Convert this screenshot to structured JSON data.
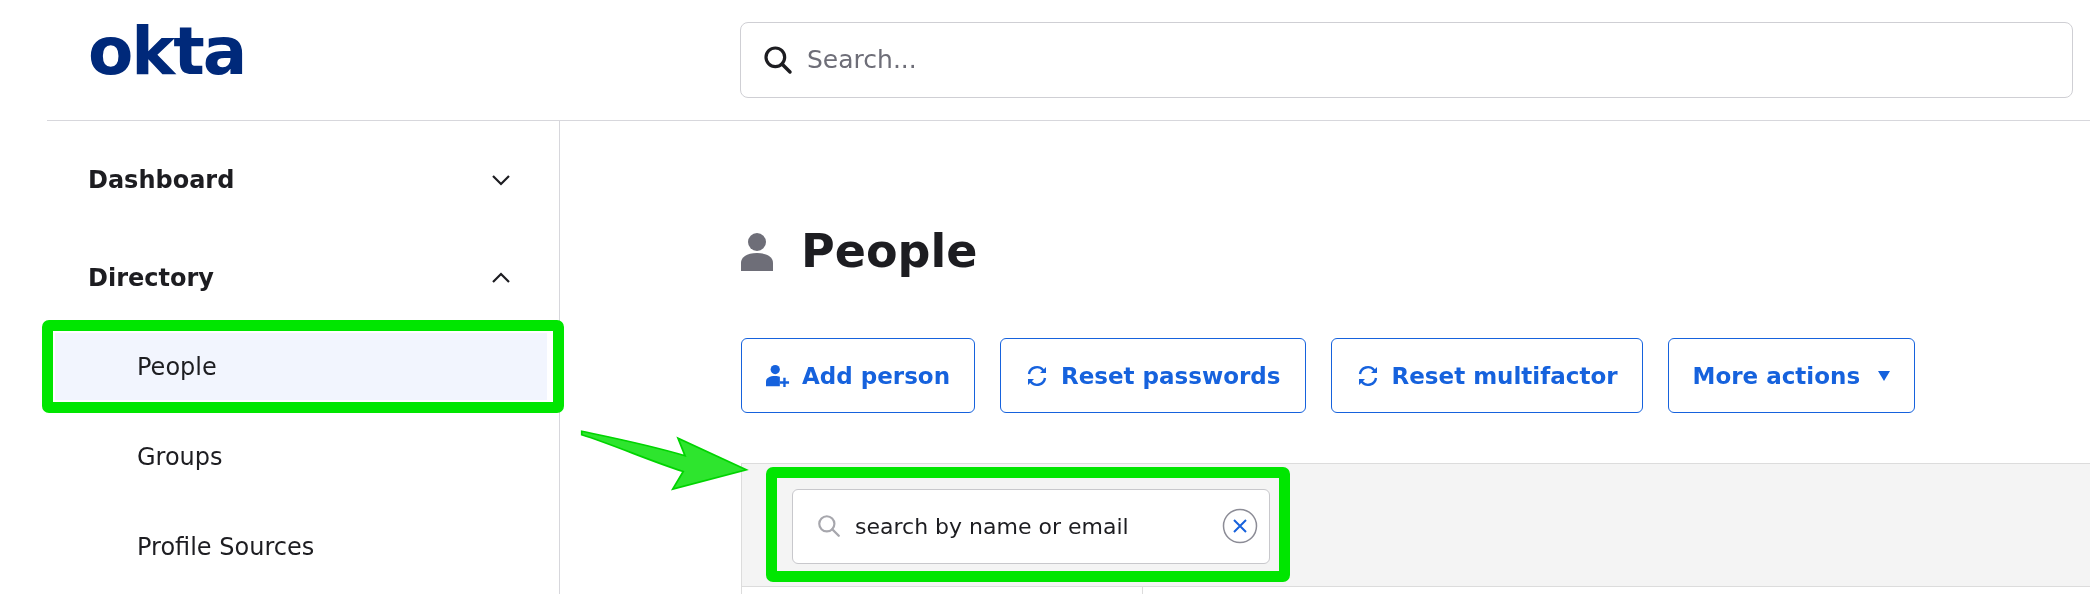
{
  "logo": "okta",
  "search": {
    "placeholder": "Search..."
  },
  "sidebar": {
    "items": [
      {
        "label": "Dashboard",
        "expanded": false
      },
      {
        "label": "Directory",
        "expanded": true,
        "children": [
          {
            "label": "People",
            "selected": true
          },
          {
            "label": "Groups",
            "selected": false
          },
          {
            "label": "Profile Sources",
            "selected": false
          }
        ]
      }
    ]
  },
  "page": {
    "title": "People",
    "buttons": [
      {
        "label": "Add person",
        "kind": "add"
      },
      {
        "label": "Reset passwords",
        "kind": "reset"
      },
      {
        "label": "Reset multifactor",
        "kind": "reset"
      },
      {
        "label": "More actions",
        "kind": "menu"
      }
    ],
    "filter": {
      "value": "search by name or email"
    }
  }
}
